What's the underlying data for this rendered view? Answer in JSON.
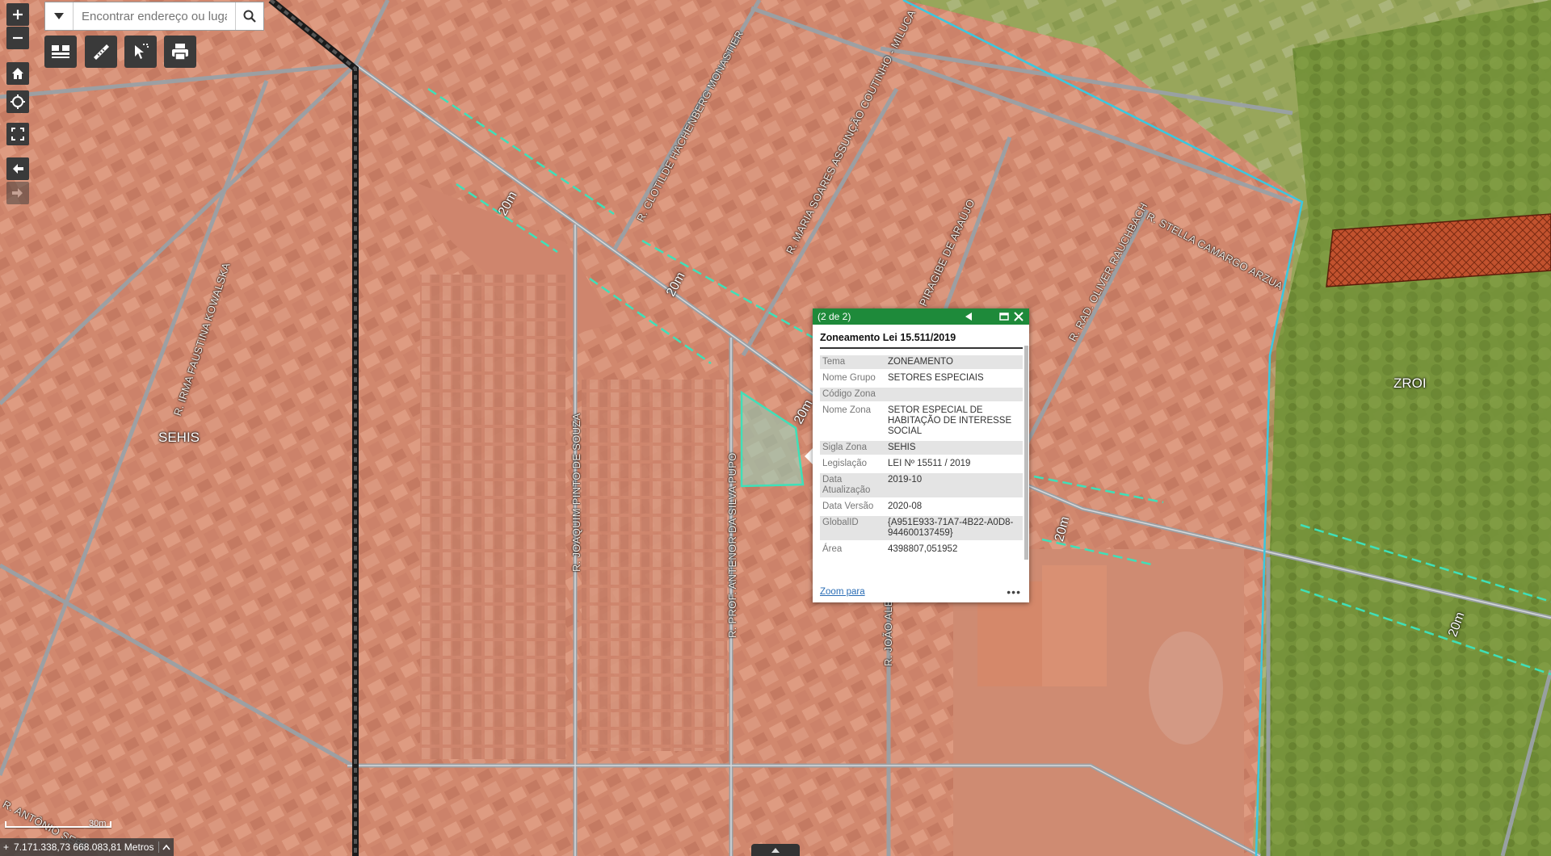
{
  "search": {
    "placeholder": "Encontrar endereço ou luga"
  },
  "controls": {
    "zoom_in": "plus-icon",
    "zoom_out": "minus-icon",
    "home": "home-icon",
    "locate": "locate-icon",
    "fullscreen": "fullscreen-icon",
    "back": "arrow-left-icon",
    "forward": "arrow-right-icon"
  },
  "toolbar": [
    "basemap-gallery-icon",
    "measure-icon",
    "select-icon",
    "print-icon"
  ],
  "map_labels": {
    "zone_sehis": "SEHIS",
    "zone_zroi": "ZROI",
    "streets": {
      "clotilde": "R. CLOTILDE HACHENBERG MONASTIER",
      "maria": "R. MARIA SOARES ASSUNÇÃO COUTINHO - MILUCA",
      "stella": "R. STELLA CAMARGO ARZUA",
      "oliver": "R. RAD. OLIVER RAUCHBACH",
      "piragibe": "PIRAGIBE DE ARAÚJO",
      "irma": "R. IRMA FAUSTINA KOWALSKA",
      "joaquim": "R. JOAQUIM PINTO DE SOUZA",
      "antenor": "R. PROF. ANTENOR DA SILVA PUPO",
      "joao": "R. JOÃO ALB",
      "antonio": "R. ANTÔNIO SEBE"
    },
    "buffer_label": "20m"
  },
  "popup": {
    "counter": "(2 de 2)",
    "title": "Zoneamento Lei 15.511/2019",
    "fields": [
      {
        "k": "Tema",
        "v": "ZONEAMENTO"
      },
      {
        "k": "Nome Grupo",
        "v": "SETORES ESPECIAIS"
      },
      {
        "k": "Código Zona",
        "v": ""
      },
      {
        "k": "Nome Zona",
        "v": "SETOR ESPECIAL DE HABITAÇÃO DE INTERESSE SOCIAL"
      },
      {
        "k": "Sigla Zona",
        "v": "SEHIS"
      },
      {
        "k": "Legislação",
        "v": "LEI Nº 15511 / 2019"
      },
      {
        "k": "Data Atualização",
        "v": "2019-10"
      },
      {
        "k": "Data Versão",
        "v": "2020-08"
      },
      {
        "k": "GlobalID",
        "v": "{A951E933-71A7-4B22-A0D8-944600137459}"
      },
      {
        "k": "Área",
        "v": "4398807,051952"
      }
    ],
    "zoom_link": "Zoom para",
    "more": "•••"
  },
  "status": {
    "coordinates": "7.171.338,73 668.083,81 Metros",
    "scale": "30m"
  },
  "colors": {
    "sehis_overlay": "#d98466",
    "zroi_overlay": "#7f9a3e",
    "popup_header": "#1e8a3a",
    "buffer_line": "#3fe0b8",
    "boundary": "#3ac8e0"
  }
}
